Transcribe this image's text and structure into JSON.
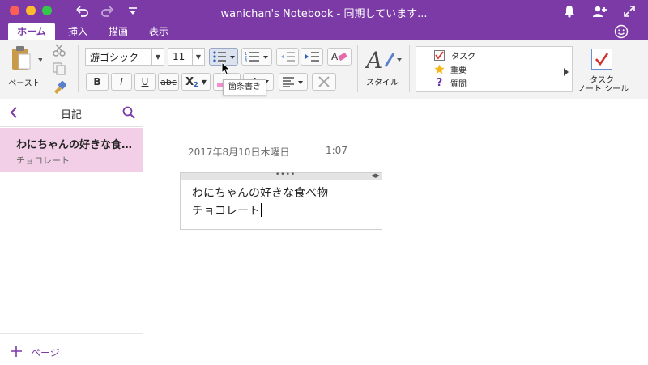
{
  "window": {
    "title": "wanichan's Notebook - 同期しています..."
  },
  "tabs": [
    {
      "label": "ホーム",
      "active": true
    },
    {
      "label": "挿入",
      "active": false
    },
    {
      "label": "描画",
      "active": false
    },
    {
      "label": "表示",
      "active": false
    }
  ],
  "ribbon": {
    "paste_label": "ペースト",
    "font_name": "游ゴシック",
    "font_size": "11",
    "styles_label": "スタイル",
    "tooltip": "箇条書き",
    "tags": [
      "タスク",
      "重要",
      "質問"
    ],
    "task_tag_label_line1": "タスク",
    "task_tag_label_line2": "ノート シール"
  },
  "sidebar": {
    "section_title": "日記",
    "pages": [
      {
        "title": "わにちゃんの好きな食…",
        "preview": "チョコレート",
        "selected": true
      }
    ],
    "add_page_label": "ページ"
  },
  "note": {
    "date": "2017年8月10日木曜日",
    "time": "1:07",
    "lines": [
      "わにちゃんの好きな食べ物",
      "チョコレート"
    ]
  },
  "colors": {
    "accent": "#7b3aa6",
    "selected_page": "#f2cfe6",
    "tag_checkbox": "#d9302c",
    "star": "#f5b81c",
    "question": "#6a2fa0"
  },
  "icons": {
    "undo": "undo-icon",
    "redo": "redo-icon",
    "notification": "bell-icon",
    "share": "add-person-icon",
    "expand": "expand-icon",
    "feedback": "smiley-icon"
  }
}
